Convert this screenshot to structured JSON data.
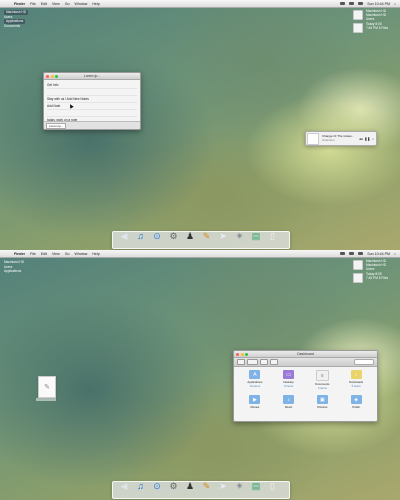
{
  "menubar": {
    "apple_glyph": "",
    "items": [
      "Finder",
      "File",
      "Edit",
      "View",
      "Go",
      "Window",
      "Help"
    ],
    "clock": "Sun 10:44 PM"
  },
  "top": {
    "desktop_items": [
      "Macintosh HD",
      "Users",
      "Applications",
      "Documents"
    ],
    "widget_top": [
      "Macintosh HD",
      "Macintosh HD",
      "Users"
    ],
    "widget_mid": [
      "Today 8:05",
      "7:45 PM  5 Files"
    ],
    "note_window": {
      "title": "Lorem Ip...",
      "lines": [
        "Get Info",
        "",
        "Stay with us / Add New Notes",
        "Add Note",
        "",
        "today, work on a note"
      ],
      "tab": "Lorem Ip..."
    },
    "itunes": {
      "title": "Change Or The Grass...",
      "subtitle": "Unknown"
    }
  },
  "bottom": {
    "desktop_items": [
      "Macintosh HD",
      "Users",
      "Applications"
    ],
    "widget_top": [
      "Macintosh HD",
      "Macintosh HD",
      "Users"
    ],
    "widget_mid": [
      "Today 8:05",
      "7:45 PM  5 Files"
    ],
    "finder": {
      "title": "Dashboard",
      "items": [
        {
          "label": "Applications",
          "sub": "13 items",
          "icon": "A"
        },
        {
          "label": "Desktop",
          "sub": "5 items",
          "icon": "▭"
        },
        {
          "label": "Documents",
          "sub": "3 items",
          "icon": "≡"
        },
        {
          "label": "Downloads",
          "sub": "5 items",
          "icon": "↓"
        },
        {
          "label": "Movies",
          "sub": "",
          "icon": "▶"
        },
        {
          "label": "Music",
          "sub": "",
          "icon": "♪"
        },
        {
          "label": "Pictures",
          "sub": "",
          "icon": "▣"
        },
        {
          "label": "Public",
          "sub": "",
          "icon": "◈"
        }
      ]
    }
  },
  "dock": {
    "icons": [
      "◀",
      "♫",
      "⊙",
      "⚙",
      "♟",
      "✎",
      "➤",
      "✷",
      "▤",
      "▯"
    ]
  },
  "colors": {
    "accent": "#4a7fc1",
    "close": "#ff5f57",
    "minimize": "#febc2e",
    "zoom": "#28c840"
  }
}
